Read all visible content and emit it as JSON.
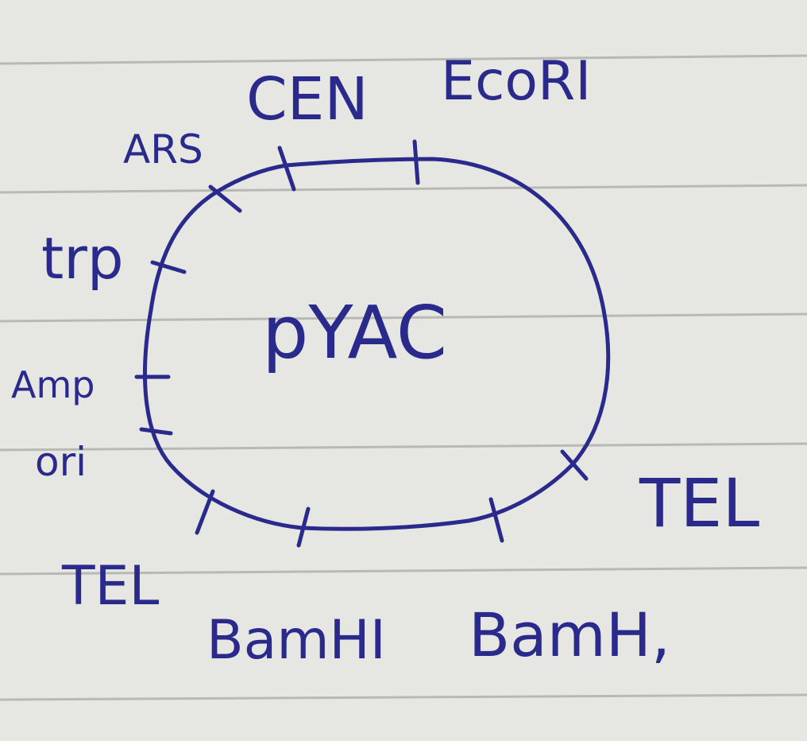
{
  "diagram": {
    "title": "pYAC",
    "ink_color": "#2a2a8c",
    "paper_color": "#e4e4e0",
    "rule_color": "#b8b8b4",
    "labels": {
      "ars": "ARS",
      "cen": "CEN",
      "ecori": "EcoRI",
      "trp": "trp",
      "amp": "Amp",
      "ori": "ori",
      "tel_left": "TEL",
      "tel_right": "TEL",
      "bamhi_left": "BamHI",
      "bamhi_right": "BamH,"
    }
  }
}
